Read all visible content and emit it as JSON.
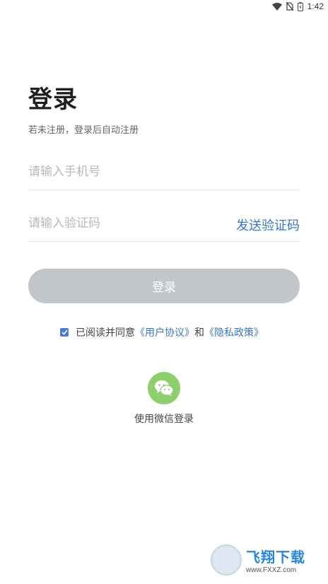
{
  "status_bar": {
    "time": "1:42",
    "icons": [
      "wifi-icon",
      "no-sim-icon",
      "battery-icon"
    ]
  },
  "header": {
    "title": "登录",
    "subtitle": "若未注册，登录后自动注册"
  },
  "form": {
    "phone_placeholder": "请输入手机号",
    "code_placeholder": "请输入验证码",
    "send_code_label": "发送验证码",
    "login_label": "登录"
  },
  "agreement": {
    "checked": true,
    "prefix": "已阅读并同意",
    "user_agreement": "《用户协议》",
    "and": "和",
    "privacy_policy": "《隐私政策》"
  },
  "wechat": {
    "icon": "wechat-icon",
    "label": "使用微信登录"
  },
  "watermark": {
    "cn": "飞翔下载",
    "en": "www.FXXZ.com"
  },
  "colors": {
    "accent": "#3b76c4",
    "button_disabled": "#c2c5ca",
    "wechat_green": "#8ccf6c",
    "checkbox": "#4a7bd8"
  }
}
